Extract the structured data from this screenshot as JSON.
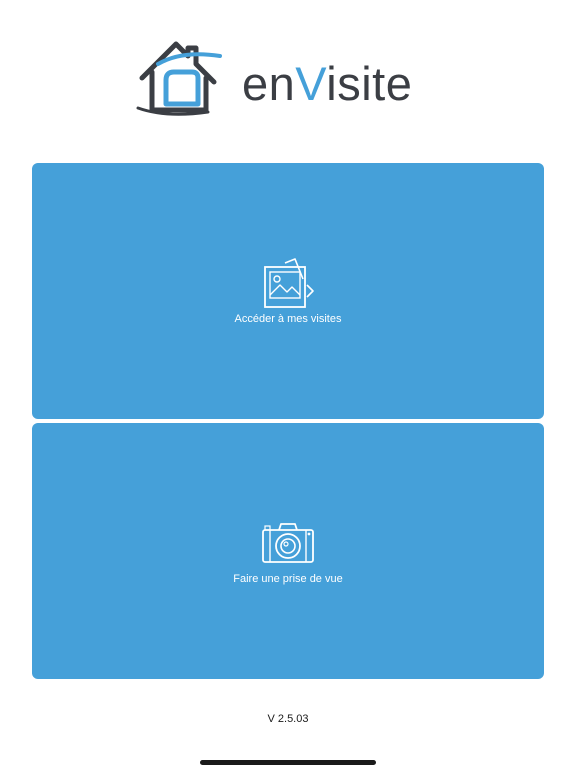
{
  "app": {
    "brand_prefix": "en",
    "brand_accent": "V",
    "brand_suffix": "isite",
    "colors": {
      "accent": "#45a0d9",
      "text_dark": "#3b3e44",
      "tile_text": "#ffffff"
    }
  },
  "actions": [
    {
      "label": "Accéder à mes visites",
      "icon": "photo-gallery-icon"
    },
    {
      "label": "Faire une prise de vue",
      "icon": "camera-icon"
    }
  ],
  "footer": {
    "version": "V 2.5.03"
  }
}
